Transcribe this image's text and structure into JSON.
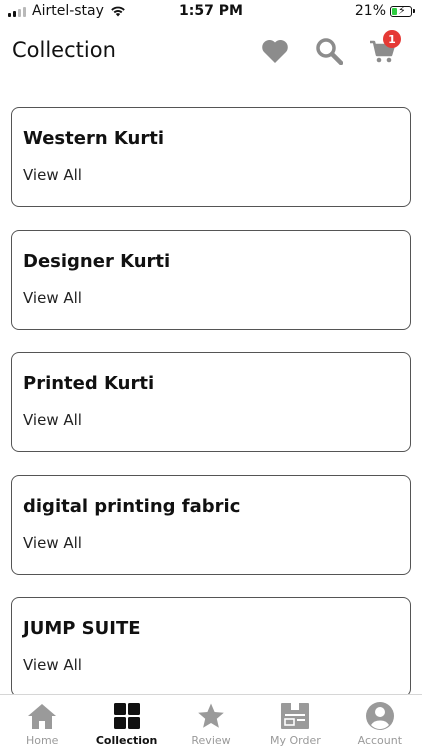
{
  "status_bar": {
    "carrier": "Airtel-stay",
    "time": "1:57 PM",
    "battery": "21%"
  },
  "header": {
    "title": "Collection",
    "cart_count": "1"
  },
  "collections": [
    {
      "title": "Western Kurti",
      "link": "View All"
    },
    {
      "title": "Designer Kurti",
      "link": "View All"
    },
    {
      "title": "Printed Kurti",
      "link": "View All"
    },
    {
      "title": "digital printing fabric",
      "link": "View All"
    },
    {
      "title": "JUMP SUITE",
      "link": "View All"
    }
  ],
  "tabs": [
    {
      "label": "Home",
      "icon": "home-icon"
    },
    {
      "label": "Collection",
      "icon": "grid-icon",
      "active": true
    },
    {
      "label": "Review",
      "icon": "star-icon"
    },
    {
      "label": "My Order",
      "icon": "order-icon"
    },
    {
      "label": "Account",
      "icon": "account-icon"
    }
  ],
  "colors": {
    "badge": "#e53935",
    "icon_gray": "#8c8c8c",
    "active_tab": "#111111"
  }
}
